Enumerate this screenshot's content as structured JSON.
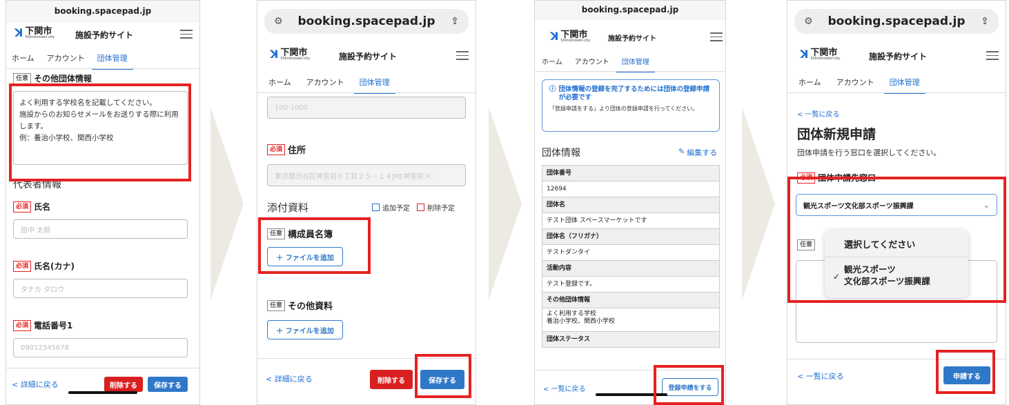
{
  "common": {
    "url": "booking.spacepad.jp",
    "city_name": "下関市",
    "city_roman": "Shimonoseki-city",
    "site_title": "施設予約サイト",
    "tabs": [
      "ホーム",
      "アカウント",
      "団体管理"
    ],
    "badge_required": "必須",
    "badge_optional": "任意"
  },
  "s1": {
    "other_info_label": "その他団体情報",
    "other_info_text": "よく利用する学校名を記載してください。\n施設からのお知らせメールをお送りする際に利用します。\n例：養治小学校、関西小学校",
    "rep_heading": "代表者情報",
    "name_label": "氏名",
    "name_placeholder": "田中 太郎",
    "kana_label": "氏名(カナ)",
    "kana_placeholder": "タナカ タロウ",
    "phone_label": "電話番号1",
    "phone_placeholder": "09012345678",
    "back_label": "< 詳細に戻る",
    "delete_label": "削除する",
    "save_label": "保存する"
  },
  "s2": {
    "postal_value": "100-1000",
    "address_label": "住所",
    "address_value": "東京都渋谷区神宮前６丁目２５－１４JRE神宮前メ:",
    "attach_heading": "添付資料",
    "legend_add": "追加予定",
    "legend_delete": "削除予定",
    "roster_label": "構成員名簿",
    "add_file_label": "＋ ファイルを追加",
    "other_docs_label": "その他資料",
    "back_label": "< 詳細に戻る",
    "delete_label": "削除する",
    "save_label": "保存する"
  },
  "s3": {
    "notice_title": "団体情報の登録を完了するためには団体の登録申請が必要です",
    "notice_body": "「登録申請をする」より団体の登録申請を行ってください。",
    "info_heading": "団体情報",
    "edit_label": "編集する",
    "rows": [
      {
        "head": "団体番号",
        "value": "12694"
      },
      {
        "head": "団体名",
        "value": "テスト団体 スペースマーケットです"
      },
      {
        "head": "団体名（フリガナ）",
        "value": "テストダンタイ"
      },
      {
        "head": "活動内容",
        "value": "テスト登録です。"
      },
      {
        "head": "その他団体情報",
        "value": "よく利用する学校\n養治小学校、関西小学校"
      },
      {
        "head": "団体ステータス",
        "value": ""
      }
    ],
    "back_label": "< 一覧に戻る",
    "apply_label": "登録申請をする"
  },
  "s4": {
    "back_top": "< 一覧に戻る",
    "title": "団体新規申請",
    "subtitle": "団体申請を行う窓口を選択してください。",
    "dest_label": "団体申請先窓口",
    "select_value": "観光スポーツ文化部スポーツ振興課",
    "options": [
      "選択してください",
      "観光スポーツ\n文化部スポーツ振興課"
    ],
    "back_label": "< 一覧に戻る",
    "submit_label": "申請する"
  },
  "colors": {
    "accent": "#1f6fd1",
    "danger": "#d91f1f",
    "highlight": "#e52222",
    "arrow": "#ede9e3"
  }
}
